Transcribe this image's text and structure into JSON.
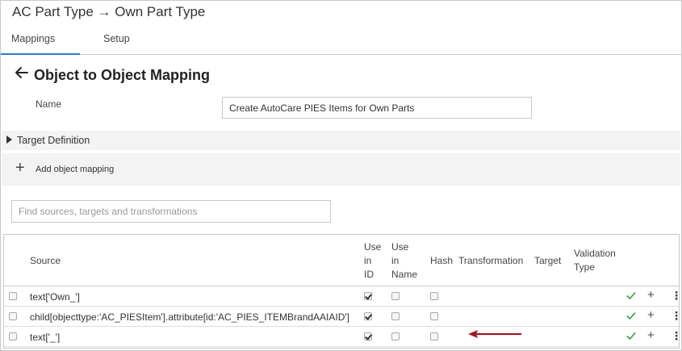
{
  "app": {
    "title": "AC Part Type → Own Part Type"
  },
  "tabs": [
    {
      "label": "Mappings",
      "active": true
    },
    {
      "label": "Setup",
      "active": false
    }
  ],
  "page": {
    "title": "Object to Object Mapping"
  },
  "name_field": {
    "label": "Name",
    "value": "Create AutoCare PIES Items for Own Parts"
  },
  "target_definition": {
    "label": "Target Definition"
  },
  "add_mapping": {
    "label": "Add object mapping"
  },
  "search": {
    "placeholder": "Find sources, targets and transformations"
  },
  "grid": {
    "columns": {
      "source": "Source",
      "use_in_id": [
        "Use",
        "in",
        "ID"
      ],
      "use_in_name": [
        "Use",
        "in",
        "Name"
      ],
      "hash": "Hash",
      "transformation": "Transformation",
      "target": "Target",
      "validation_type": [
        "Validation",
        "Type"
      ]
    },
    "rows": [
      {
        "source": "text['Own_']",
        "use_in_id": true,
        "use_in_name": false,
        "hash": false
      },
      {
        "source": "child[objecttype:'AC_PIESItem'].attribute[id:'AC_PIES_ITEMBrandAAIAID']",
        "use_in_id": true,
        "use_in_name": false,
        "hash": false
      },
      {
        "source": "text['_']",
        "use_in_id": true,
        "use_in_name": false,
        "hash": false
      }
    ]
  },
  "colors": {
    "accent": "#2b7fc1",
    "check_green": "#3c9a3c",
    "annotation_arrow": "#9b1c24"
  }
}
